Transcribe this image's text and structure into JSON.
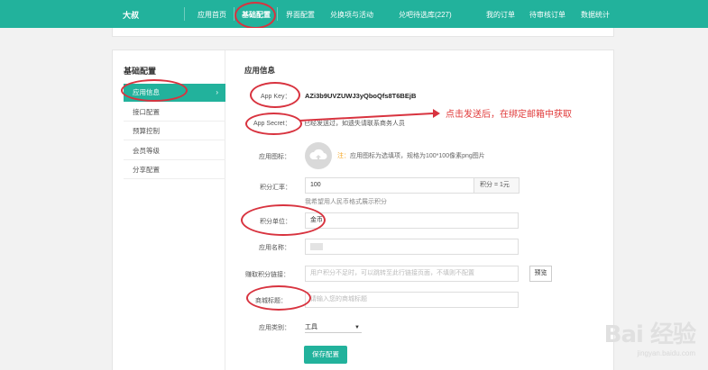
{
  "header": {
    "brand": "大叔",
    "nav": [
      {
        "label": "应用首页"
      },
      {
        "label": "基础配置",
        "active": true
      },
      {
        "label": "界面配置"
      },
      {
        "label": "兑换项与活动"
      },
      {
        "label": "兑吧待选库(227)"
      },
      {
        "label": "我的订单"
      },
      {
        "label": "待审核订单"
      },
      {
        "label": "数据统计"
      }
    ]
  },
  "sidebar": {
    "title": "基础配置",
    "items": [
      {
        "label": "应用信息",
        "active": true
      },
      {
        "label": "接口配置"
      },
      {
        "label": "预算控制"
      },
      {
        "label": "会员等级"
      },
      {
        "label": "分享配置"
      }
    ]
  },
  "main": {
    "title": "应用信息",
    "app_key_label": "App Key：",
    "app_key_value": "AZi3b9UVZUWJ3yQboQfs8T6BEjB",
    "app_secret_label": "App Secret：",
    "app_secret_value": "已经发送过，如遗失请联系商务人员",
    "icon_label": "应用图标：",
    "icon_note_prefix": "注：",
    "icon_note": "应用图标为选填项，规格为100*100像素png图片",
    "rate_label": "积分汇率：",
    "rate_value": "100",
    "rate_addon": "积分 = 1元",
    "rate_hint": "我希望用人民币格式展示积分",
    "unit_label": "积分单位：",
    "unit_value": "金币",
    "name_label": "应用名称：",
    "earn_label": "赚取积分链接：",
    "earn_placeholder": "用户积分不足时，可以跳转至此行链接页面，不填则不配置",
    "preview_button": "预览",
    "mall_label": "商城标题：",
    "mall_placeholder": "请输入您的商城标题",
    "category_label": "应用类别：",
    "category_value": "工具",
    "save_button": "保存配置"
  },
  "annotation": {
    "text": "点击发送后，在绑定邮箱中获取",
    "color": "#e03a3a"
  },
  "watermark": {
    "logo": "Bai 经验",
    "sub": "jingyan.baidu.com"
  },
  "colors": {
    "accent": "#22b29c",
    "annotation": "#d8333f"
  }
}
